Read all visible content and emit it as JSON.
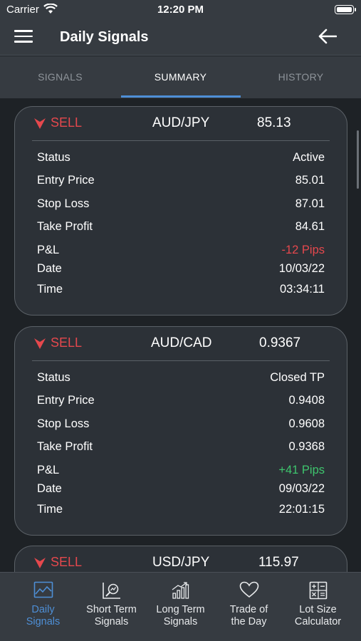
{
  "status_bar": {
    "carrier": "Carrier",
    "time": "12:20 PM"
  },
  "header": {
    "title": "Daily Signals",
    "menu_icon": "hamburger-menu-icon",
    "back_icon": "arrow-left-icon"
  },
  "tabs": [
    {
      "label": "SIGNALS",
      "active": false
    },
    {
      "label": "SUMMARY",
      "active": true
    },
    {
      "label": "HISTORY",
      "active": false
    }
  ],
  "accent_color": "#4e8fd6",
  "sell_color": "#e5484d",
  "profit_color": "#3ec46d",
  "signals": [
    {
      "action": "SELL",
      "pair": "AUD/JPY",
      "price": "85.13",
      "rows": [
        {
          "label": "Status",
          "value": "Active"
        },
        {
          "label": "Entry Price",
          "value": "85.01"
        },
        {
          "label": "Stop Loss",
          "value": "87.01"
        },
        {
          "label": "Take Profit",
          "value": "84.61"
        },
        {
          "label": "P&L",
          "value": "-12 Pips"
        },
        {
          "label": "Date",
          "value": "10/03/22"
        },
        {
          "label": "Time",
          "value": "03:34:11"
        }
      ]
    },
    {
      "action": "SELL",
      "pair": "AUD/CAD",
      "price": "0.9367",
      "rows": [
        {
          "label": "Status",
          "value": "Closed TP"
        },
        {
          "label": "Entry Price",
          "value": "0.9408"
        },
        {
          "label": "Stop Loss",
          "value": "0.9608"
        },
        {
          "label": "Take Profit",
          "value": "0.9368"
        },
        {
          "label": "P&L",
          "value": "+41 Pips"
        },
        {
          "label": "Date",
          "value": "09/03/22"
        },
        {
          "label": "Time",
          "value": "22:01:15"
        }
      ]
    },
    {
      "action": "SELL",
      "pair": "USD/JPY",
      "price": "115.97"
    }
  ],
  "bottom_nav": [
    {
      "label_line1": "Daily",
      "label_line2": "Signals",
      "icon": "chart-area-icon",
      "active": true
    },
    {
      "label_line1": "Short Term",
      "label_line2": "Signals",
      "icon": "chart-search-icon",
      "active": false
    },
    {
      "label_line1": "Long Term",
      "label_line2": "Signals",
      "icon": "bar-chart-growth-icon",
      "active": false
    },
    {
      "label_line1": "Trade of",
      "label_line2": "the Day",
      "icon": "heart-icon",
      "active": false
    },
    {
      "label_line1": "Lot Size",
      "label_line2": "Calculator",
      "icon": "calculator-icon",
      "active": false
    }
  ]
}
